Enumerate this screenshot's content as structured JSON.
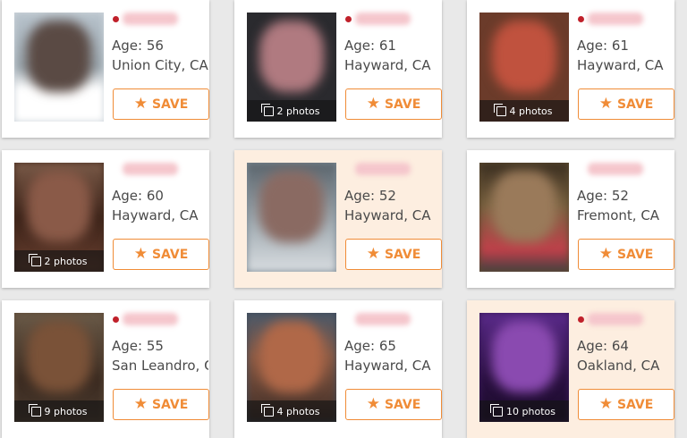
{
  "accent_color": "#f08c37",
  "highlight_color": "#fdeee0",
  "save_label": "SAVE",
  "profiles": [
    {
      "age": "Age: 56",
      "location": "Union City, CA",
      "photos": "",
      "highlighted": false
    },
    {
      "age": "Age: 61",
      "location": "Hayward, CA",
      "photos": "2 photos",
      "highlighted": false
    },
    {
      "age": "Age: 61",
      "location": "Hayward, CA",
      "photos": "4 photos",
      "highlighted": false
    },
    {
      "age": "Age: 60",
      "location": "Hayward, CA",
      "photos": "2 photos",
      "highlighted": false
    },
    {
      "age": "Age: 52",
      "location": "Hayward, CA",
      "photos": "",
      "highlighted": true
    },
    {
      "age": "Age: 52",
      "location": "Fremont, CA",
      "photos": "",
      "highlighted": false
    },
    {
      "age": "Age: 55",
      "location": "San Leandro, CA",
      "photos": "9 photos",
      "highlighted": false
    },
    {
      "age": "Age: 65",
      "location": "Hayward, CA",
      "photos": "4 photos",
      "highlighted": false
    },
    {
      "age": "Age: 64",
      "location": "Oakland, CA",
      "photos": "10 photos",
      "highlighted": true
    }
  ]
}
